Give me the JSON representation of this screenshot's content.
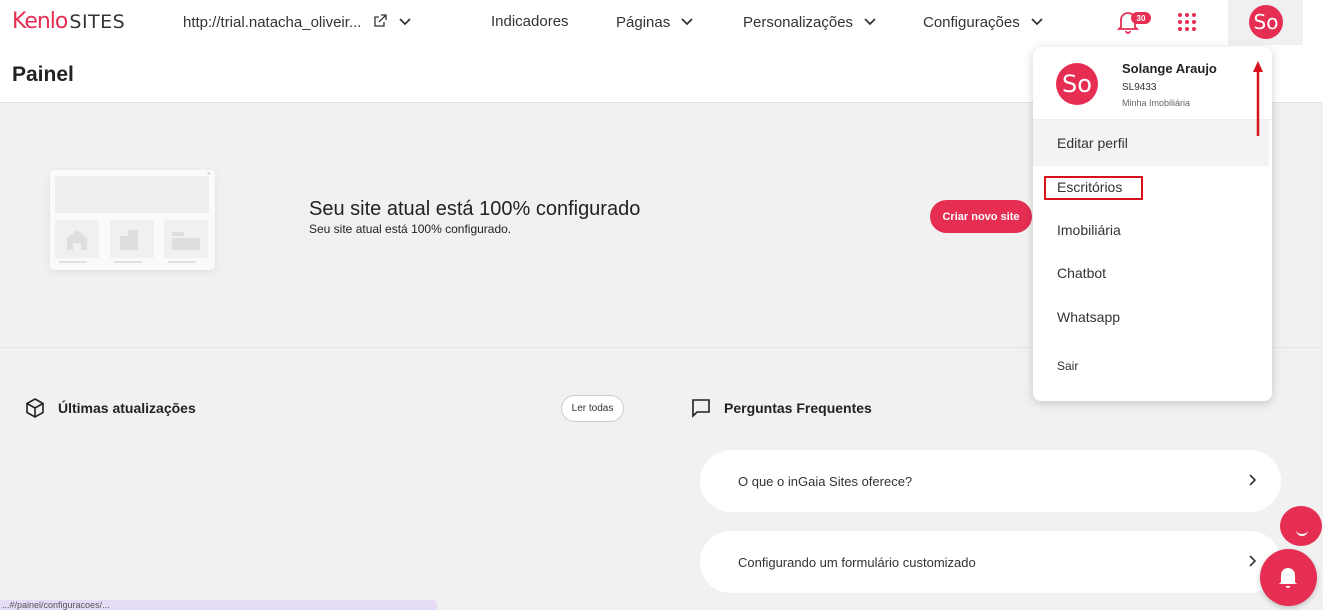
{
  "header": {
    "logo_brand": "Kenlo",
    "logo_product": "SITES",
    "site_url": "http://trial.natacha_oliveir...",
    "nav": [
      {
        "label": "Indicadores"
      },
      {
        "label": "Páginas"
      },
      {
        "label": "Personalizações"
      },
      {
        "label": "Configurações"
      }
    ],
    "notifications_count": "30",
    "avatar_initials": "So"
  },
  "page": {
    "title": "Painel"
  },
  "hero": {
    "title": "Seu site atual está 100% configurado",
    "subtitle": "Seu site atual está 100% configurado.",
    "create_button": "Criar novo site"
  },
  "updates": {
    "title": "Últimas atualizações",
    "read_all": "Ler todas"
  },
  "faq": {
    "title": "Perguntas Frequentes",
    "items": [
      {
        "question": "O que o inGaia Sites oferece?"
      },
      {
        "question": "Configurando um formulário customizado"
      }
    ]
  },
  "user_menu": {
    "avatar_initials": "So",
    "name": "Solange Araujo",
    "code": "SL9433",
    "company": "Minha Imobiliária",
    "items": [
      {
        "label": "Editar perfil"
      },
      {
        "label": "Escritórios"
      },
      {
        "label": "Imobiliária"
      },
      {
        "label": "Chatbot"
      },
      {
        "label": "Whatsapp"
      },
      {
        "label": "Sair"
      }
    ]
  },
  "status_bar": {
    "url": "...#/painel/configuracoes/..."
  },
  "colors": {
    "brand": "#e62e53",
    "annotation": "#d8121d"
  }
}
